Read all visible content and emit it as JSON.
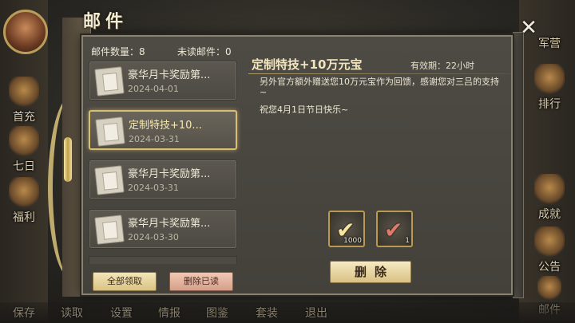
{
  "title": "邮件",
  "counts": {
    "total_label": "邮件数量：8",
    "unread_label": "未读邮件：0"
  },
  "mails": [
    {
      "subject": "豪华月卡奖励第...",
      "date": "2024-04-01"
    },
    {
      "subject": "定制特技+10...",
      "date": "2024-03-31"
    },
    {
      "subject": "豪华月卡奖励第...",
      "date": "2024-03-31"
    },
    {
      "subject": "豪华月卡奖励第...",
      "date": "2024-03-30"
    }
  ],
  "buttons": {
    "claim_all": "全部领取",
    "delete_read": "删除已读",
    "delete": "删除"
  },
  "detail": {
    "title": "定制特技+10万元宝",
    "expiry": "有效期：22小时",
    "body_1": "另外官方额外赠送您10万元宝作为回馈，感谢您对三吕的支持~",
    "body_2": "祝您4月1日节日快乐~"
  },
  "rewards": [
    {
      "qty": "1000",
      "icon": "check-reward-icon"
    },
    {
      "qty": "1",
      "icon": "check-reward-icon"
    }
  ],
  "side_right": [
    "军营",
    "排行",
    "成就",
    "公告",
    "邮件"
  ],
  "side_left": [
    "首充",
    "七日",
    "福利"
  ],
  "bottom_bar": [
    "保存",
    "读取",
    "设置",
    "情报",
    "图鉴",
    "套装",
    "退出"
  ],
  "close_glyph": "✕"
}
